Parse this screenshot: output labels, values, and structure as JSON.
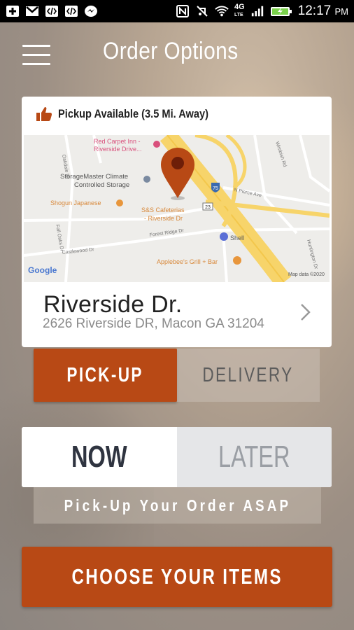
{
  "status_bar": {
    "time": "12:17",
    "ampm": "PM",
    "network": "4G",
    "network_sub": "LTE"
  },
  "header": {
    "title": "Order Options"
  },
  "store": {
    "availability": "Pickup Available (3.5 Mi. Away)",
    "name": "Riverside Dr.",
    "address": "2626 Riverside DR, Macon GA 31204"
  },
  "map": {
    "labels": {
      "red_carpet": "Red Carpet Inn -",
      "red_carpet2": "Riverside Drive...",
      "storagemaster": "StorageMaster Climate",
      "storagemaster2": "Controlled Storage",
      "shogun": "Shogun Japanese",
      "sands": "S&S Cafeterias",
      "sands2": "- Riverside Dr",
      "shell": "Shell",
      "applebees": "Applebee's Grill + Bar",
      "i75": "75",
      "us23": "23",
      "pierce": "N Pierce Ave",
      "castlewood": "Castlewood Dr",
      "forest_ridge": "Forest Ridge Dr",
      "oakdale": "Oakdale Dr",
      "fall_oaks": "Fall Oaks Dr",
      "huntington": "Huntington Dr",
      "wimbish": "Wimbish Rd",
      "google": "Google",
      "map_data": "Map data ©2020"
    }
  },
  "order_method": {
    "pickup_label": "PICK-UP",
    "delivery_label": "DELIVERY",
    "selected": "pickup"
  },
  "order_time": {
    "now_label": "NOW",
    "later_label": "LATER",
    "selected": "now",
    "note": "Pick-Up Your Order ASAP"
  },
  "cta": {
    "label": "CHOOSE YOUR ITEMS"
  },
  "colors": {
    "brand": "#b84915",
    "status_bar": "#000000"
  }
}
